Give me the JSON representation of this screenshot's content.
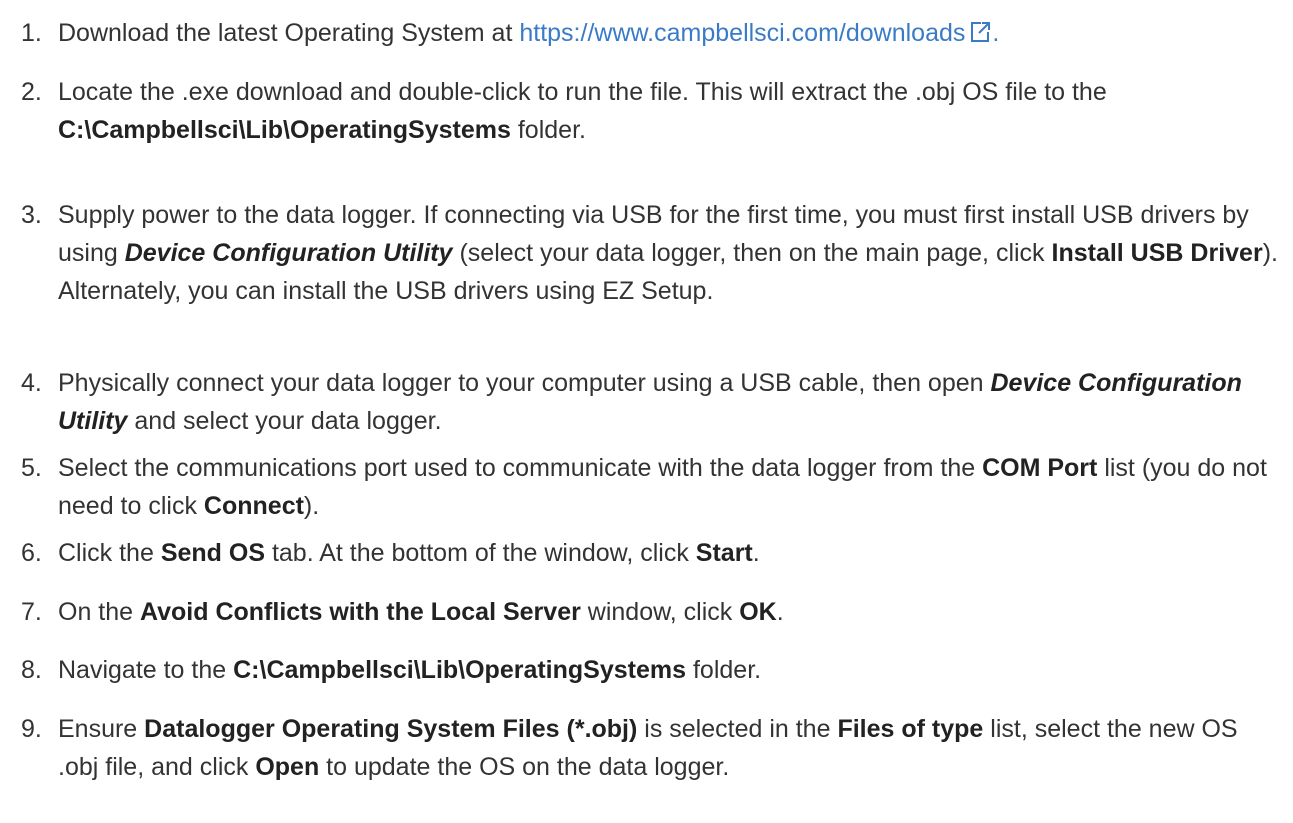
{
  "steps": [
    {
      "number": "1.",
      "text_before": "Download the latest Operating System at ",
      "link_text": "https://www.campbellsci.com/downloads",
      "text_after": "."
    },
    {
      "number": "2.",
      "t1": "Locate the .exe download and double-click to run the file. This will extract the .obj OS file to the ",
      "b1": "C:\\Campbellsci\\Lib\\OperatingSystems",
      "t2": " folder."
    },
    {
      "number": "3.",
      "t1": "Supply power to the data logger. If connecting via USB for the first time, you must first install USB drivers by using ",
      "i1": "Device Configuration Utility",
      "t2": " (select your data logger, then on the main page, click ",
      "b1": "Install USB Driver",
      "t3": "). Alternately, you can install the USB drivers using EZ Setup."
    },
    {
      "number": "4.",
      "t1": "Physically connect your data logger to your computer using a USB cable, then open ",
      "i1": "Device Configuration Utility",
      "t2": " and select your data logger."
    },
    {
      "number": "5.",
      "t1": "Select the communications port used to communicate with the data logger from the ",
      "b1": "COM Port",
      "t2": " list (you do not need to click ",
      "b2": "Connect",
      "t3": ")."
    },
    {
      "number": "6.",
      "t1": "Click the ",
      "b1": "Send OS",
      "t2": " tab. At the bottom of the window, click ",
      "b2": "Start",
      "t3": "."
    },
    {
      "number": "7.",
      "t1": "On the ",
      "b1": "Avoid Conflicts with the Local Server",
      "t2": " window, click ",
      "b2": "OK",
      "t3": "."
    },
    {
      "number": "8.",
      "t1": "Navigate to the ",
      "b1": "C:\\Campbellsci\\Lib\\OperatingSystems",
      "t2": " folder."
    },
    {
      "number": "9.",
      "t1": "Ensure ",
      "b1": "Datalogger Operating System Files (*.obj)",
      "t2": " is selected in the ",
      "b2": "Files of type",
      "t3": " list, select the new OS .obj file, and click ",
      "b3": "Open",
      "t4": " to update the OS on the data logger."
    }
  ],
  "icons": {
    "external_link": "external-link-icon"
  },
  "colors": {
    "text": "#333333",
    "link": "#3a7bc8"
  }
}
